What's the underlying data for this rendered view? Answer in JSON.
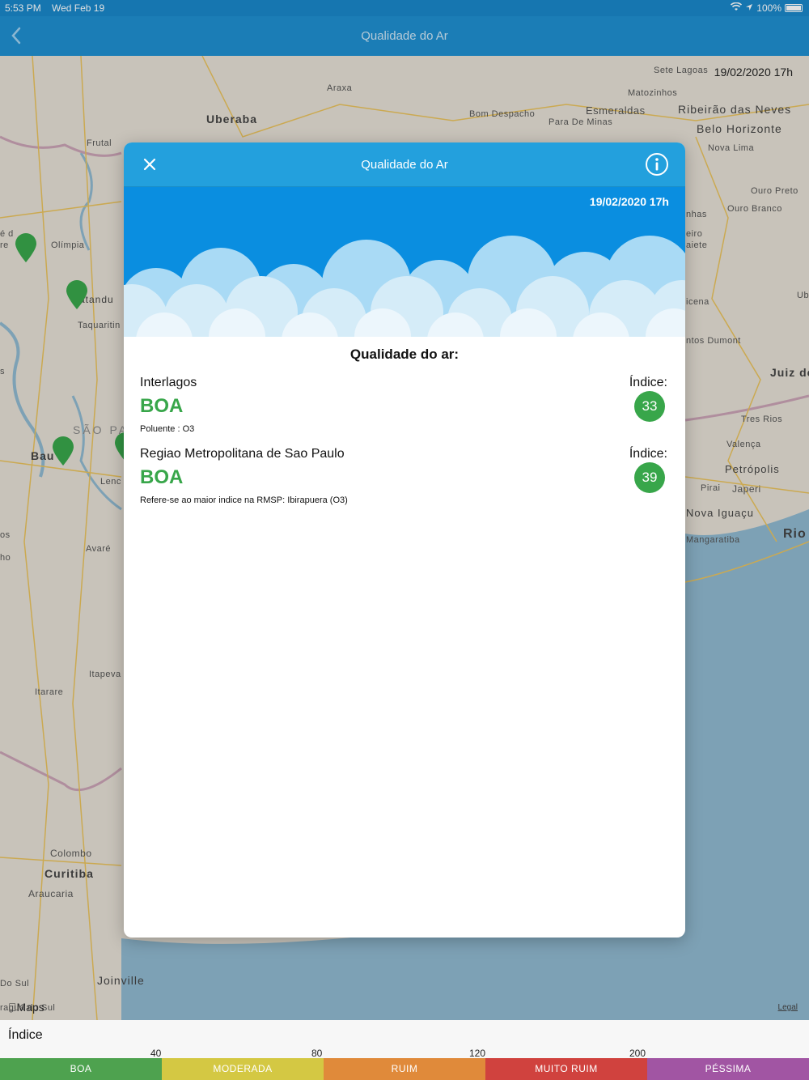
{
  "status_bar": {
    "time": "5:53 PM",
    "date": "Wed Feb 19",
    "battery": "100%"
  },
  "nav": {
    "title": "Qualidade do Ar"
  },
  "map": {
    "timestamp": "19/02/2020 17h",
    "labels": [
      "Sete Lagoas",
      "Araxa",
      "Matozinhos",
      "Uberaba",
      "Esmeraldas",
      "Ribeirão das Neves",
      "Bom Despacho",
      "Para De Minas",
      "Belo Horizonte",
      "Frutal",
      "Nova Lima",
      "Ouro Preto",
      "Ouro Branco",
      "nhas",
      "eiro",
      "aiete",
      "Olímpia",
      "atandu",
      "Taquaritin",
      "icena",
      "ntos Dumont",
      "Juiz de",
      "SÃO PA",
      "Bau",
      "Lenc",
      "Tres Rios",
      "Valença",
      "Petrópolis",
      "Pirai",
      "Japeri",
      "Nova Iguaçu",
      "Rio",
      "Mangaratiba",
      "Avaré",
      "Itapeva",
      "Itarare",
      "Colombo",
      "Curitiba",
      "Araucaria",
      "Joinville",
      "Do Sul",
      "raguá do Sul",
      "Ub",
      "é d",
      "re",
      "os",
      "ho",
      "s"
    ],
    "maps_brand": "Maps",
    "legal": "Legal"
  },
  "modal": {
    "title": "Qualidade do Ar",
    "timestamp": "19/02/2020 17h",
    "heading": "Qualidade do ar:",
    "stations": [
      {
        "name": "Interlagos",
        "quality": "BOA",
        "note": "Poluente : O3",
        "index_label": "Índice:",
        "index": "33"
      },
      {
        "name": "Regiao Metropolitana de Sao Paulo",
        "quality": "BOA",
        "note": "Refere-se ao maior indice na RMSP: Ibirapuera (O3)",
        "index_label": "Índice:",
        "index": "39"
      }
    ]
  },
  "index_panel": {
    "title": "Índice",
    "ticks": [
      "40",
      "80",
      "120",
      "200"
    ],
    "categories": [
      {
        "label": "BOA",
        "color": "#4ea24f"
      },
      {
        "label": "MODERADA",
        "color": "#d4c843"
      },
      {
        "label": "RUIM",
        "color": "#e08a3a"
      },
      {
        "label": "MUITO RUIM",
        "color": "#d0423e"
      },
      {
        "label": "PÉSSIMA",
        "color": "#a155a3"
      }
    ]
  },
  "colors": {
    "nav": "#1f8fd0",
    "good": "#38a64a"
  }
}
